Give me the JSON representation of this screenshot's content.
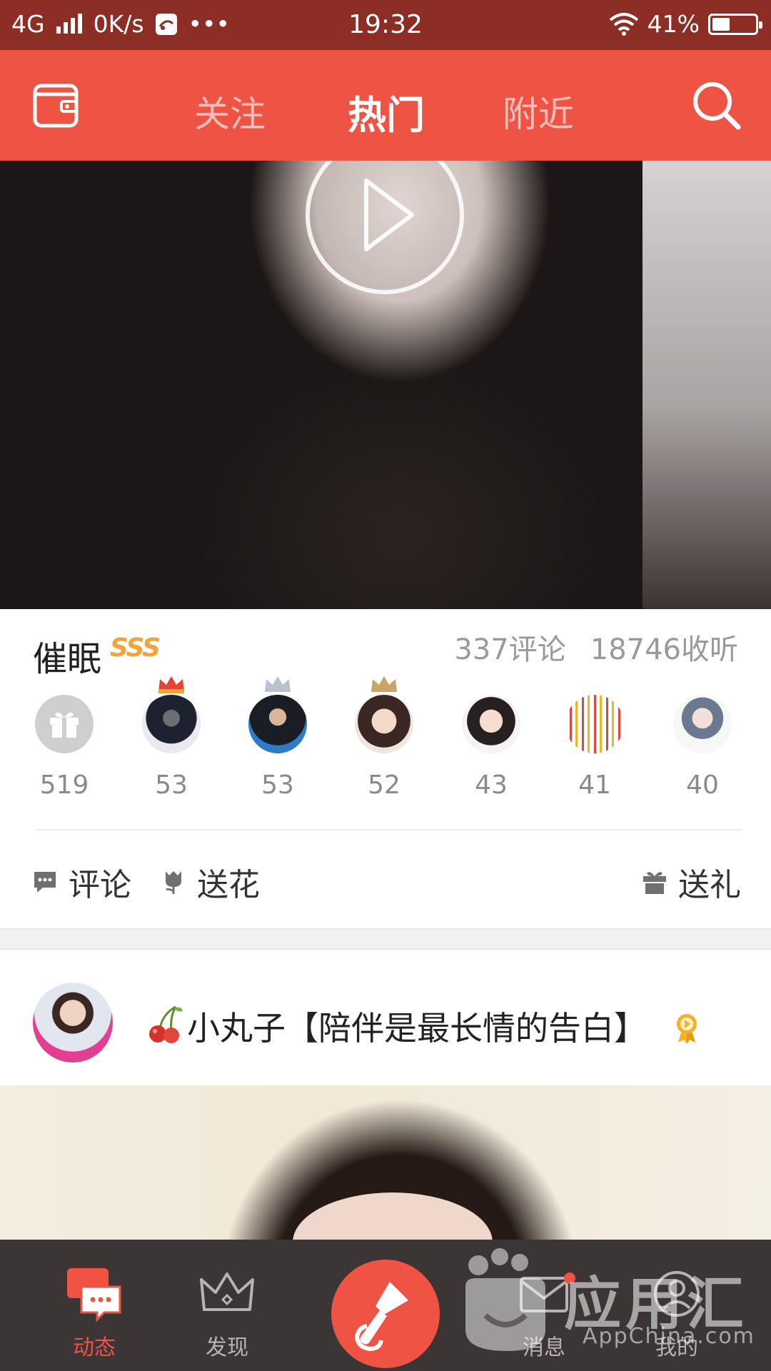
{
  "status_bar": {
    "network": "4G",
    "speed": "0K/s",
    "more": "•••",
    "time": "19:32",
    "battery": "41%",
    "battery_level": 0.41
  },
  "top_nav": {
    "tabs": [
      {
        "label": "关注",
        "active": false
      },
      {
        "label": "热门",
        "active": true
      },
      {
        "label": "附近",
        "active": false
      }
    ],
    "accent_color": "#ef5344"
  },
  "feed": {
    "item1": {
      "title": "催眠",
      "level_badge": "SSS",
      "comments": "337评论",
      "listens": "18746收听",
      "gifters": [
        {
          "count": "519",
          "type": "gift-icon"
        },
        {
          "count": "53",
          "crown": "gold"
        },
        {
          "count": "53",
          "crown": "silver"
        },
        {
          "count": "52",
          "crown": "bronze"
        },
        {
          "count": "43"
        },
        {
          "count": "41"
        },
        {
          "count": "40"
        }
      ],
      "actions": {
        "comment": "评论",
        "flower": "送花",
        "gift": "送礼"
      }
    },
    "item2": {
      "title": "小丸子【陪伴是最长情的告白】"
    }
  },
  "bottom_nav": {
    "items": [
      {
        "label": "动态",
        "active": true
      },
      {
        "label": "发现",
        "active": false
      },
      {
        "label": "消息",
        "active": false
      },
      {
        "label": "我的",
        "active": false
      }
    ]
  },
  "watermark": {
    "title": "应用汇",
    "subtitle": "AppChina.com"
  }
}
